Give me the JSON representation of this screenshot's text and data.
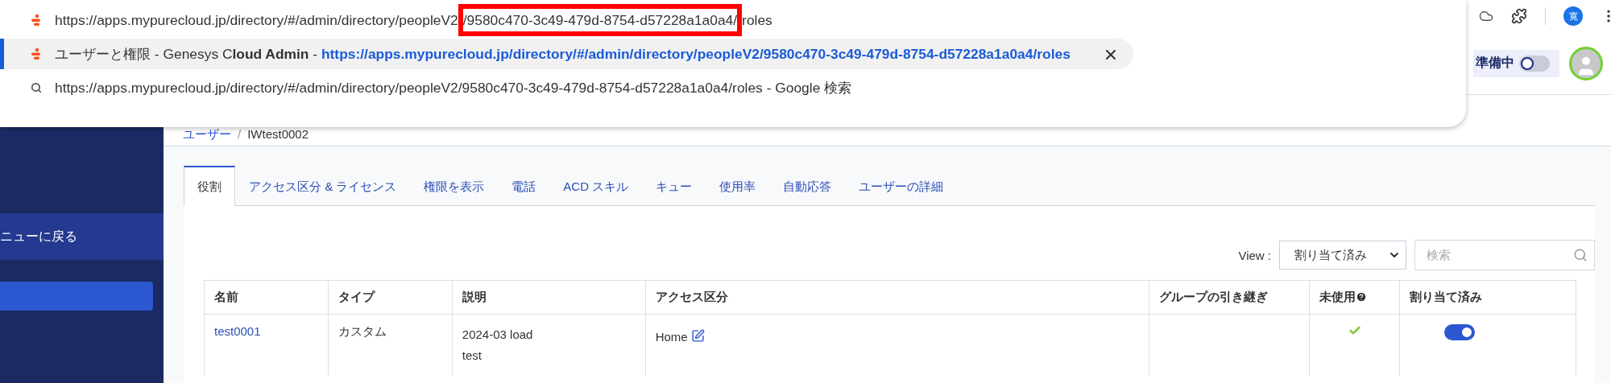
{
  "omnibox": {
    "rows": [
      {
        "kind": "url",
        "parts": [
          {
            "text": "https://apps.mypurecloud.jp/directory/#/admin/directory/peopleV2",
            "annotated": false
          },
          {
            "text": "/9580c470-3c49-479d-8754-d57228a1a0a4/",
            "annotated": true
          },
          {
            "text": "roles",
            "annotated": false
          }
        ],
        "selected": false
      },
      {
        "kind": "page",
        "title": "ユーザーと権限 - Genesys C",
        "title_bold": "loud Admin",
        "separator": " - ",
        "url": "https://apps.mypurecloud.jp/directory/#/admin/directory/peopleV2/9580c470-3c49-479d-8754-d57228a1a0a4/roles",
        "selected": true
      },
      {
        "kind": "search",
        "text": "https://apps.mypurecloud.jp/directory/#/admin/directory/peopleV2/9580c470-3c49-479d-8754-d57228a1a0a4/roles",
        "suffix": " - Google 検索",
        "selected": false
      }
    ]
  },
  "browser": {
    "profile_initial": "寛"
  },
  "header": {
    "status": "準備中",
    "status_on": false
  },
  "sidebar": {
    "items": [
      {
        "label": "ニューに戻る",
        "selected": false
      }
    ]
  },
  "breadcrumb": {
    "parent": "ユーザー",
    "separator": "/",
    "current": "IWtest0002"
  },
  "tabs": [
    {
      "label": "役割",
      "selected": true
    },
    {
      "label": "アクセス区分 & ライセンス",
      "selected": false
    },
    {
      "label": "権限を表示",
      "selected": false
    },
    {
      "label": "電話",
      "selected": false
    },
    {
      "label": "ACD スキル",
      "selected": false
    },
    {
      "label": "キュー",
      "selected": false
    },
    {
      "label": "使用率",
      "selected": false
    },
    {
      "label": "自動応答",
      "selected": false
    },
    {
      "label": "ユーザーの詳細",
      "selected": false
    }
  ],
  "filter": {
    "view_label": "View :",
    "view_value": "割り当て済み",
    "search_placeholder": "検索"
  },
  "table": {
    "columns": [
      "名前",
      "タイプ",
      "説明",
      "アクセス区分",
      "グループの引き継ぎ",
      "未使用",
      "割り当て済み"
    ],
    "rows": [
      {
        "name": "test0001",
        "type": "カスタム",
        "description": [
          "2024-03 load",
          "test"
        ],
        "division": "Home",
        "unused": true,
        "assigned": true
      }
    ]
  }
}
